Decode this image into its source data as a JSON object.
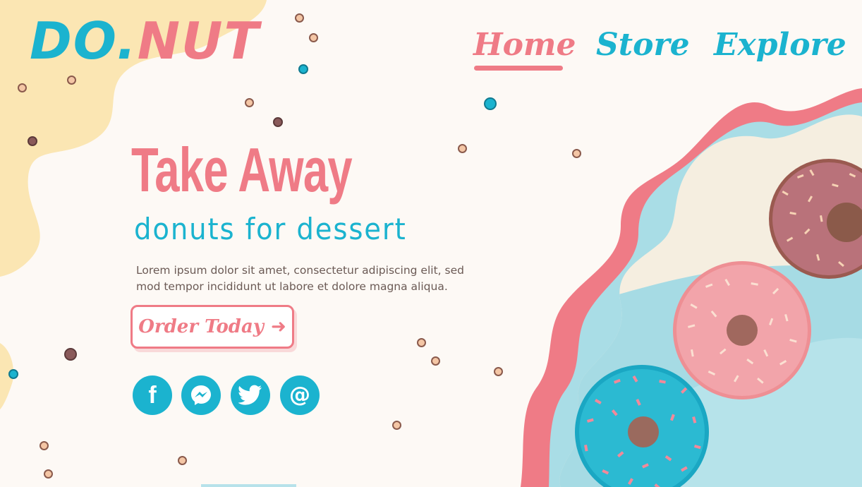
{
  "logo": {
    "part1": "DO.",
    "part2": "NUT"
  },
  "nav": {
    "home": "Home",
    "store": "Store",
    "explore": "Explore"
  },
  "hero": {
    "headline": "Take Away",
    "subhead": "donuts for dessert",
    "body": "Lorem ipsum dolor sit amet, consectetur adipiscing elit, sed mod tempor incididunt ut labore et dolore magna aliqua."
  },
  "cta": {
    "label": "Order Today",
    "arrow": "➜"
  },
  "social": {
    "facebook_glyph": "f",
    "email_glyph": "@",
    "icons": [
      "facebook-icon",
      "messenger-icon",
      "twitter-icon",
      "email-icon"
    ]
  },
  "colors": {
    "pink": "#ef7b86",
    "teal": "#1bb3cf",
    "cream": "#fbe6b3",
    "background": "#fdf9f5",
    "text": "#6b5a55"
  }
}
